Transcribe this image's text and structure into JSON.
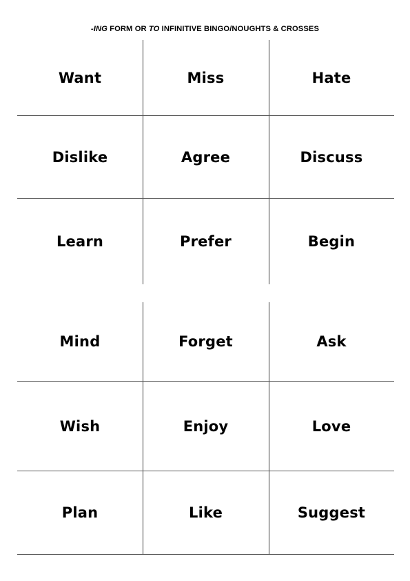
{
  "document": {
    "title_parts": [
      {
        "text": "-ING",
        "style": "italic"
      },
      {
        "text": " FORM OR ",
        "style": "normal"
      },
      {
        "text": "TO",
        "style": "italic"
      },
      {
        "text": " INFINITIVE BINGO/NOUGHTS & CROSSES",
        "style": "normal"
      }
    ],
    "title_plain": "-ING FORM OR TO INFINITIVE BINGO/NOUGHTS & CROSSES"
  },
  "colors": {
    "page_background": "#ffffff",
    "text": "#000000",
    "grid_vertical_line": "#3a3a3a",
    "grid_horizontal_line": "#808080"
  },
  "bingo_grid": {
    "columns": 3,
    "rows": 6,
    "cells": [
      [
        "Want",
        "Miss",
        "Hate"
      ],
      [
        "Dislike",
        "Agree",
        "Discuss"
      ],
      [
        "Learn",
        "Prefer",
        "Begin"
      ],
      [
        "Mind",
        "Forget",
        "Ask"
      ],
      [
        "Wish",
        "Enjoy",
        "Love"
      ],
      [
        "Plan",
        "Like",
        "Suggest"
      ]
    ],
    "flat": [
      "Want",
      "Miss",
      "Hate",
      "Dislike",
      "Agree",
      "Discuss",
      "Learn",
      "Prefer",
      "Begin",
      "Mind",
      "Forget",
      "Ask",
      "Wish",
      "Enjoy",
      "Love",
      "Plan",
      "Like",
      "Suggest"
    ]
  }
}
